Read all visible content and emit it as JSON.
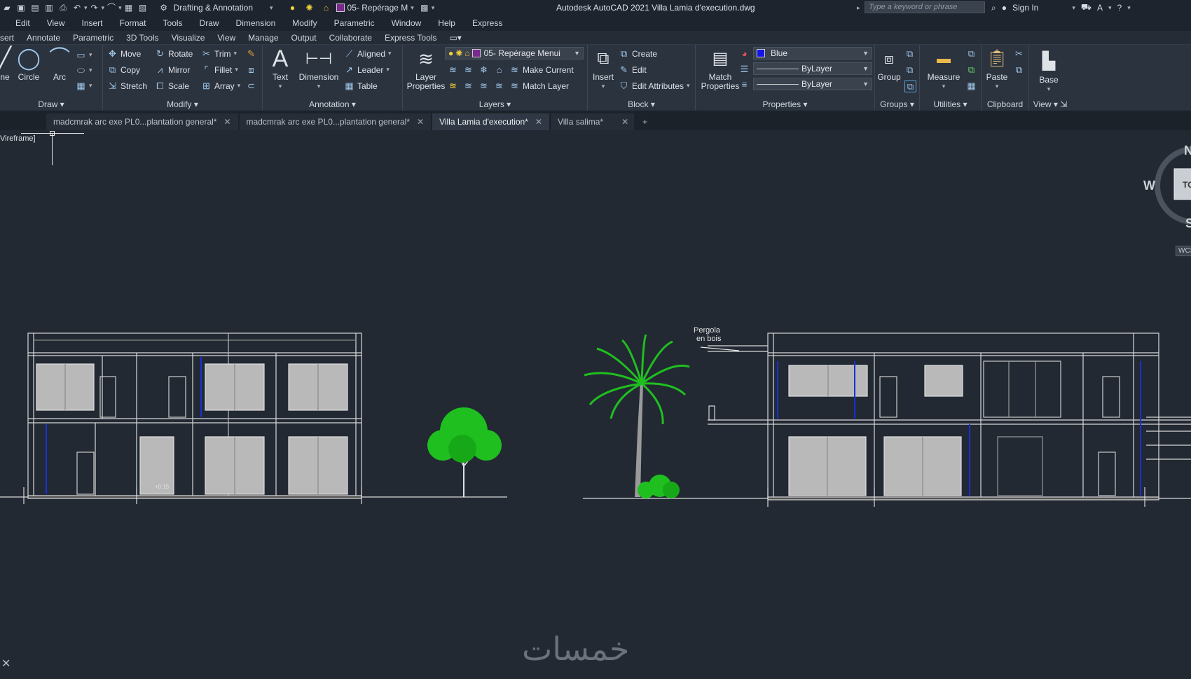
{
  "title_bar": {
    "workspace": "Drafting & Annotation",
    "layer": "05- Repérage M",
    "app_title": "Autodesk AutoCAD 2021    Villa Lamia d'execution.dwg",
    "search_placeholder": "Type a keyword or phrase",
    "sign_in": "Sign In"
  },
  "menu": [
    "Edit",
    "View",
    "Insert",
    "Format",
    "Tools",
    "Draw",
    "Dimension",
    "Modify",
    "Parametric",
    "Window",
    "Help",
    "Express"
  ],
  "ribbon_tabs": [
    "sert",
    "Annotate",
    "Parametric",
    "3D Tools",
    "Visualize",
    "View",
    "Manage",
    "Output",
    "Collaborate",
    "Express Tools"
  ],
  "ribbon": {
    "draw": {
      "title": "Draw",
      "line": "ne",
      "circle": "Circle",
      "arc": "Arc"
    },
    "modify": {
      "title": "Modify",
      "move": "Move",
      "rotate": "Rotate",
      "trim": "Trim",
      "copy": "Copy",
      "mirror": "Mirror",
      "fillet": "Fillet",
      "stretch": "Stretch",
      "scale": "Scale",
      "array": "Array"
    },
    "annotation": {
      "title": "Annotation",
      "text": "Text",
      "dimension": "Dimension",
      "aligned": "Aligned",
      "leader": "Leader",
      "table": "Table"
    },
    "layers": {
      "title": "Layers",
      "layer_properties": "Layer Properties",
      "current_layer": "05- Repérage Menui",
      "make_current": "Make Current",
      "match_layer": "Match Layer"
    },
    "block": {
      "title": "Block",
      "insert": "Insert",
      "create": "Create",
      "edit": "Edit",
      "edit_attributes": "Edit Attributes"
    },
    "properties": {
      "title": "Properties",
      "match_properties": "Match Properties",
      "color": "Blue",
      "color_hex": "#1414e6",
      "linetype": "ByLayer",
      "lineweight": "ByLayer"
    },
    "groups": {
      "title": "Groups",
      "group": "Group"
    },
    "utilities": {
      "title": "Utilities",
      "measure": "Measure"
    },
    "clipboard": {
      "title": "Clipboard",
      "paste": "Paste"
    },
    "view": {
      "title": "View",
      "base": "Base"
    }
  },
  "doc_tabs": [
    {
      "label": "madcmrak arc exe PL0...plantation general*",
      "active": false
    },
    {
      "label": "madcmrak arc exe PL0...plantation general*",
      "active": false
    },
    {
      "label": "Villa Lamia d'execution*",
      "active": true
    },
    {
      "label": "Villa salima*",
      "active": false
    }
  ],
  "viewport": {
    "view_label": "Vireframe]",
    "compass": {
      "north": "N",
      "west": "W",
      "south": "S",
      "top": "TO",
      "wcs": "WCS"
    },
    "annotations": {
      "pergola_line1": "Pergola",
      "pergola_line2": "en bois",
      "level": "+0.15"
    }
  },
  "watermark": "خمسات",
  "colors": {
    "canvas": "#222933",
    "ribbon": "#2b333f",
    "tree_green": "#1fbf1f",
    "dim_blue": "#1a2fd8"
  }
}
